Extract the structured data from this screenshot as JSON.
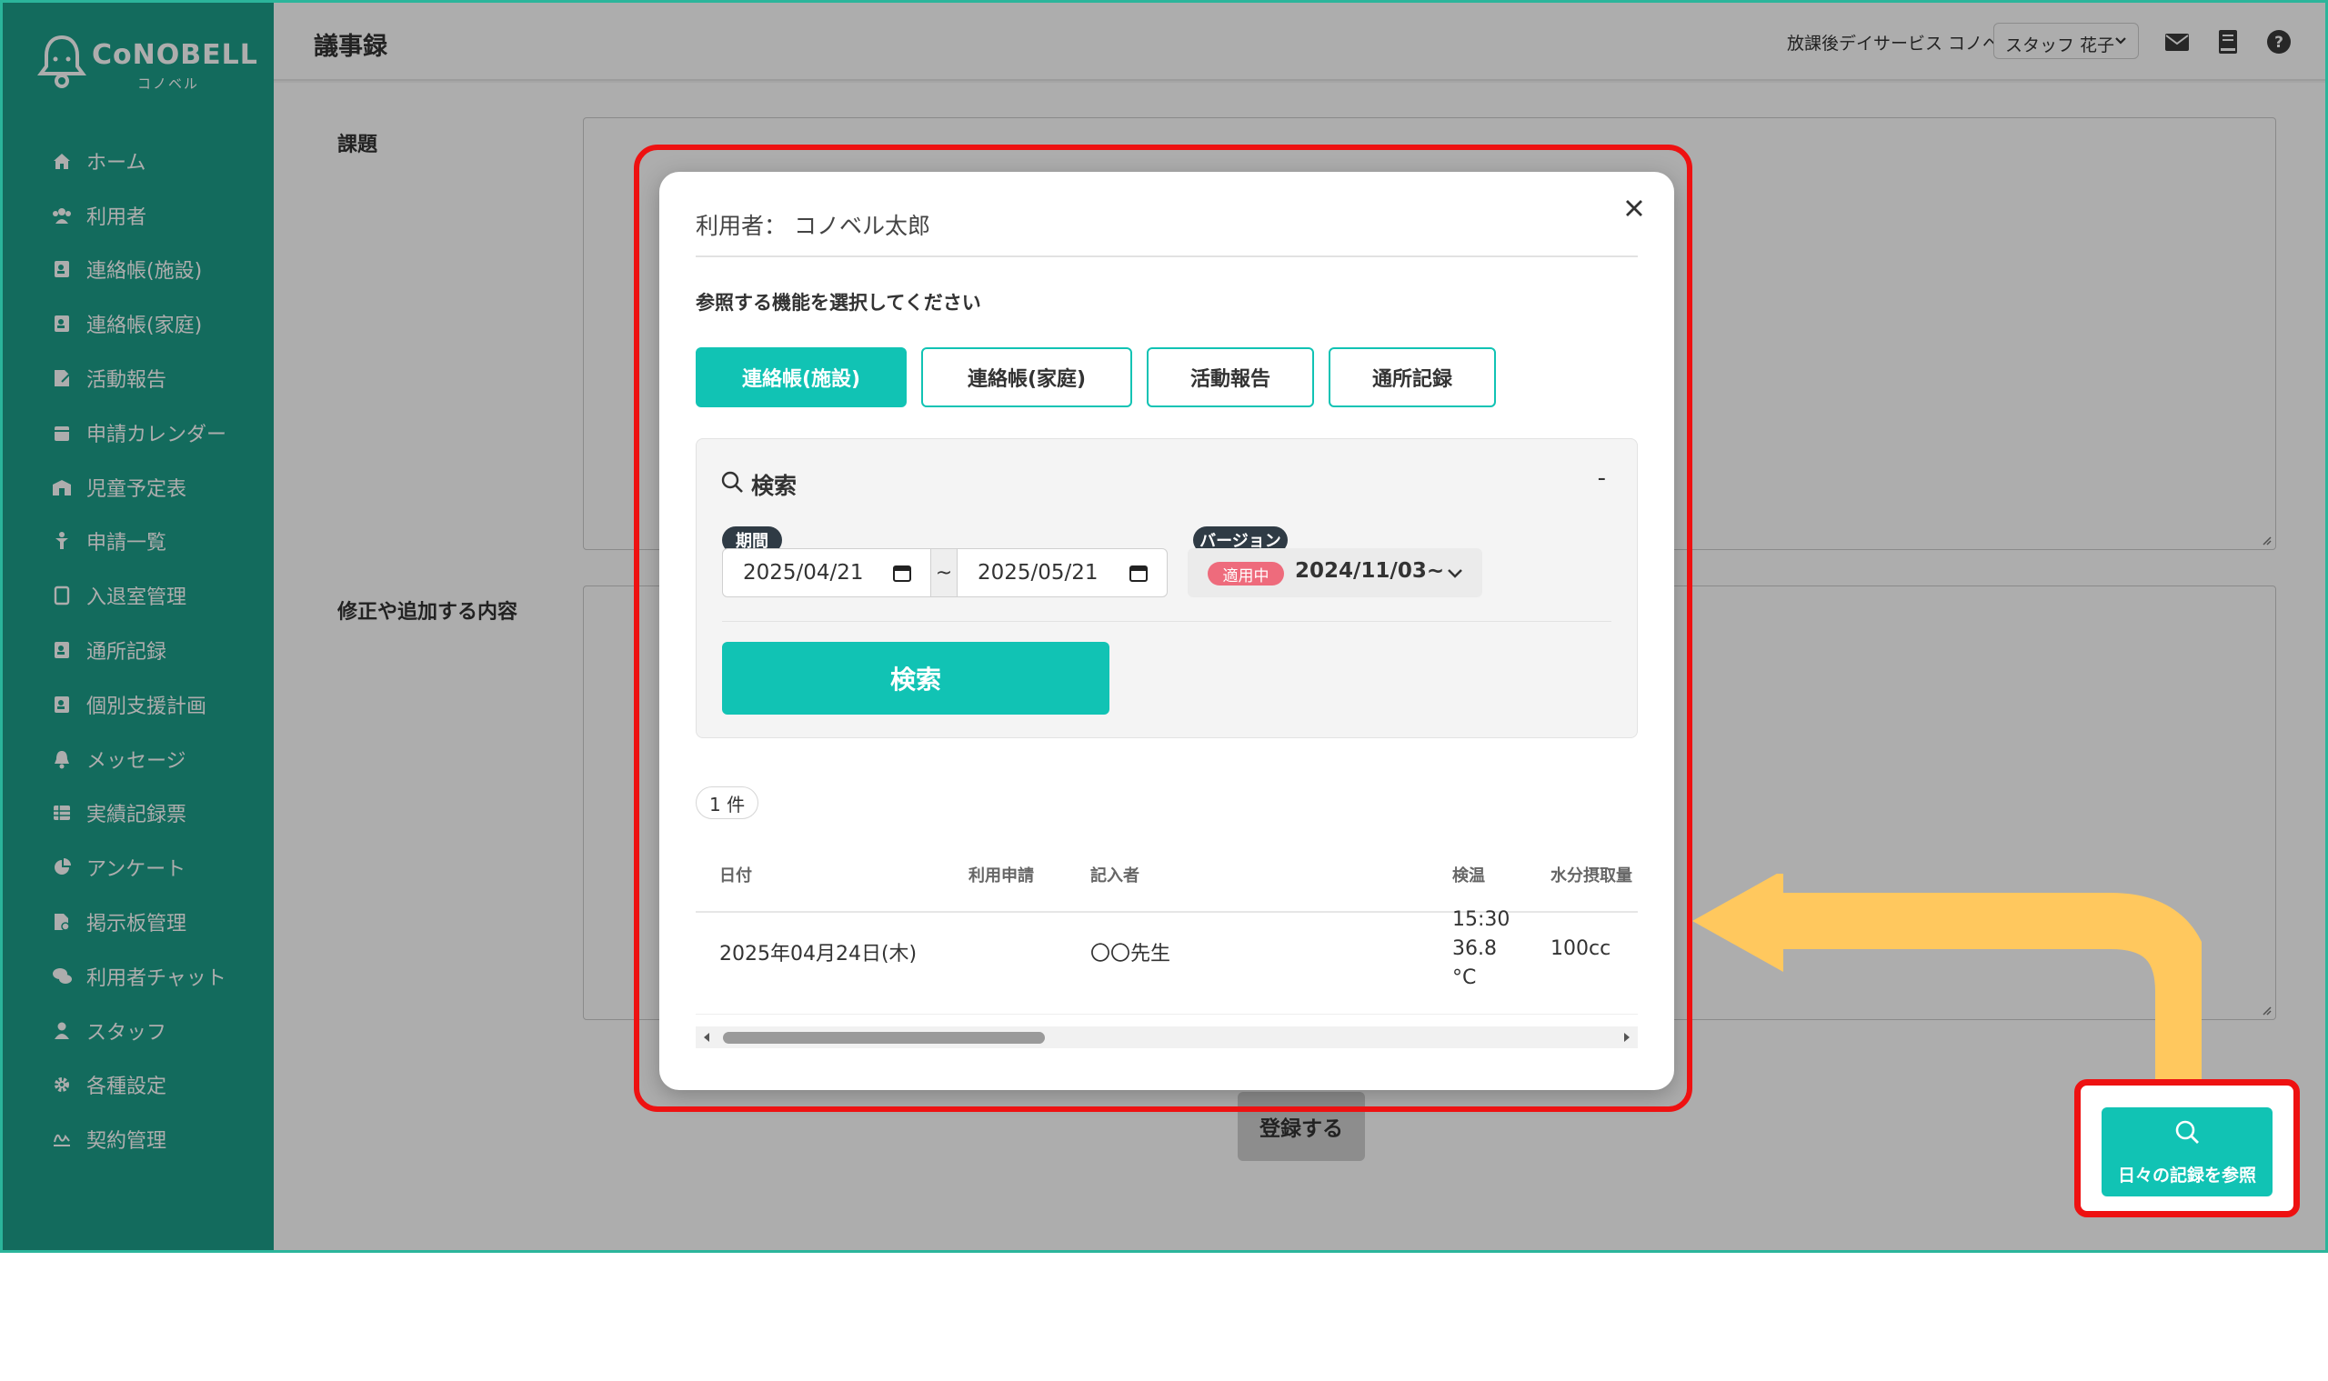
{
  "app": {
    "logo_text": "CoNOBELL",
    "logo_sub": "コノベル"
  },
  "sidebar": {
    "items": [
      {
        "label": "ホーム",
        "icon": "home-icon"
      },
      {
        "label": "利用者",
        "icon": "users-icon"
      },
      {
        "label": "連絡帳(施設)",
        "icon": "contact-book-icon"
      },
      {
        "label": "連絡帳(家庭)",
        "icon": "contact-book-icon"
      },
      {
        "label": "活動報告",
        "icon": "report-edit-icon"
      },
      {
        "label": "申請カレンダー",
        "icon": "calendar-icon"
      },
      {
        "label": "児童予定表",
        "icon": "schedule-icon"
      },
      {
        "label": "申請一覧",
        "icon": "child-icon"
      },
      {
        "label": "入退室管理",
        "icon": "tablet-icon"
      },
      {
        "label": "通所記録",
        "icon": "contact-book-icon"
      },
      {
        "label": "個別支援計画",
        "icon": "contact-book-icon"
      },
      {
        "label": "メッセージ",
        "icon": "bell-icon"
      },
      {
        "label": "実績記録票",
        "icon": "table-icon"
      },
      {
        "label": "アンケート",
        "icon": "pie-chart-icon"
      },
      {
        "label": "掲示板管理",
        "icon": "file-icon"
      },
      {
        "label": "利用者チャット",
        "icon": "chat-icon"
      },
      {
        "label": "スタッフ",
        "icon": "user-icon"
      },
      {
        "label": "各種設定",
        "icon": "gear-icon"
      },
      {
        "label": "契約管理",
        "icon": "signature-icon"
      }
    ]
  },
  "header": {
    "title": "議事録",
    "facility": "放課後デイサービス コノベル",
    "staff": "スタッフ 花子"
  },
  "form": {
    "issue_label": "課題",
    "additions_label": "修正や追加する内容",
    "register_label": "登録する"
  },
  "modal": {
    "user_line": "利用者： コノベル太郎",
    "select_prompt": "参照する機能を選択してください",
    "tabs": [
      {
        "label": "連絡帳(施設)",
        "active": true
      },
      {
        "label": "連絡帳(家庭)",
        "active": false
      },
      {
        "label": "活動報告",
        "active": false
      },
      {
        "label": "通所記録",
        "active": false
      }
    ],
    "search": {
      "title": "検索",
      "collapse": "-",
      "period_label": "期間",
      "date_from": "2025/04/21",
      "tilde": "~",
      "date_to": "2025/05/21",
      "version_label": "バージョン",
      "in_use_badge": "適用中",
      "version_value": "2024/11/03~",
      "submit": "検索"
    },
    "count": "1 件",
    "table": {
      "columns": [
        "日付",
        "利用申請",
        "記入者",
        "検温",
        "水分摂取量"
      ],
      "rows": [
        {
          "date": "2025年04月24日(木)",
          "application": "",
          "writer": "〇〇先生",
          "temp_time": "15:30",
          "temp_value": "36.8",
          "temp_unit": "°C",
          "water": "100cc"
        }
      ]
    }
  },
  "reference_button": {
    "label": "日々の記録を参照"
  },
  "colors": {
    "sidebar": "#1d9e8a",
    "accent": "#11c3b4",
    "highlight": "#ee1111",
    "arrow": "#ffc85e",
    "badge": "#ee6b7c"
  }
}
